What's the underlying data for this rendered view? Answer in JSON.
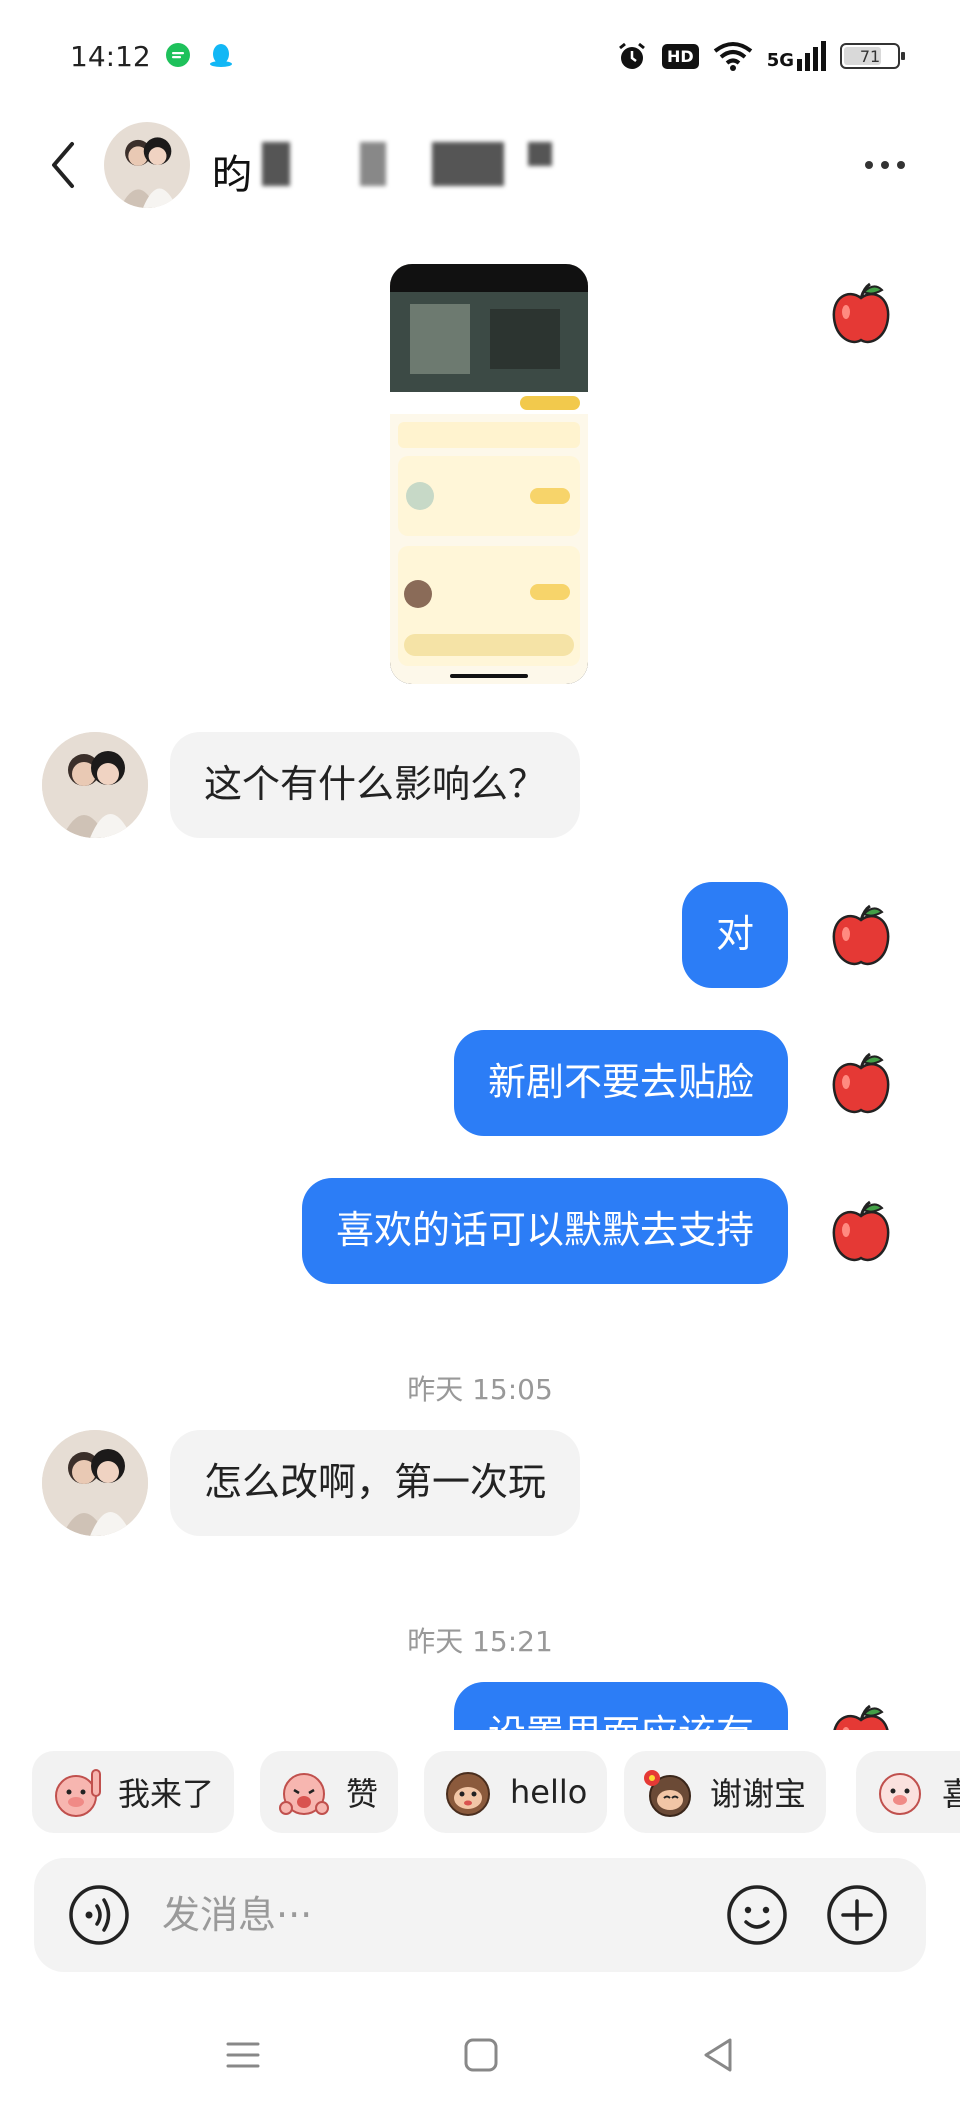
{
  "status_bar": {
    "time": "14:12",
    "network": "5G",
    "hd": "HD",
    "battery": "71",
    "battery_level_percent": 71
  },
  "header": {
    "contact_name": "昀"
  },
  "messages": [
    {
      "side": "in",
      "text": "这个有什么影响么？"
    },
    {
      "side": "out",
      "text": "对"
    },
    {
      "side": "out",
      "text": "新剧不要去贴脸"
    },
    {
      "side": "out",
      "text": "喜欢的话可以默默去支持"
    },
    {
      "side": "time",
      "text": "昨天 15:05"
    },
    {
      "side": "in",
      "text": "怎么改啊，第一次玩"
    },
    {
      "side": "time",
      "text": "昨天 15:21"
    },
    {
      "side": "out",
      "text": "设置里面应该有"
    }
  ],
  "quick_replies": [
    "我来了",
    "赞",
    "hello",
    "谢谢宝",
    "喜"
  ],
  "input": {
    "placeholder": "发消息···"
  },
  "colors": {
    "outgoing_bubble": "#2c7df6",
    "incoming_bubble": "#f3f3f3",
    "timestamp": "#999999"
  }
}
